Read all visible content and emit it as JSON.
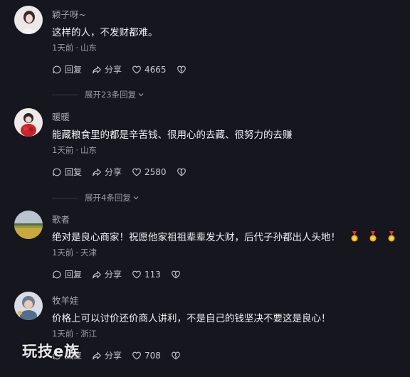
{
  "comments": [
    {
      "username": "颖子呀~",
      "text": "这样的人，不发财都难。",
      "time": "1天前",
      "location": "山东",
      "reply_label": "回复",
      "share_label": "分享",
      "likes": "4665",
      "expand_label": "展开23条回复"
    },
    {
      "username": "暖暖",
      "text": "能藏粮食里的都是辛苦钱、很用心的去藏、很努力的去赚",
      "time": "1天前",
      "location": "山东",
      "reply_label": "回复",
      "share_label": "分享",
      "likes": "2580",
      "expand_label": "展开4条回复"
    },
    {
      "username": "歌者",
      "text": "绝对是良心商家！祝愿他家祖祖辈辈发大财，后代子孙都出人头地！",
      "time": "1天前",
      "location": "天津",
      "reply_label": "回复",
      "share_label": "分享",
      "likes": "113"
    },
    {
      "username": "牧羊娃",
      "text": "价格上可以讨价还价商人讲利，不是自己的钱坚决不要这是良心！",
      "time": "1天前",
      "location": "浙江",
      "reply_label": "回复",
      "share_label": "分享",
      "likes": "708"
    }
  ],
  "watermark": "玩技e族",
  "colors": {
    "background": "#16161e",
    "primary_text": "#f0f0f3",
    "secondary_text": "#9a9aa2"
  },
  "icons": [
    "reply-icon",
    "share-icon",
    "heart-icon",
    "broken-heart-icon",
    "chevron-down-icon",
    "medal-emoji"
  ]
}
